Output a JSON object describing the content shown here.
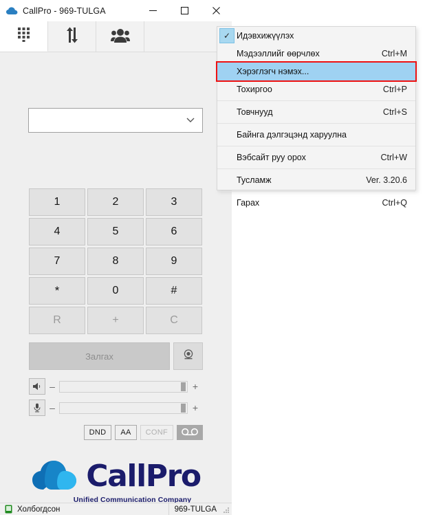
{
  "window": {
    "title": "CallPro - 969-TULGA",
    "app_icon": "cloud-icon",
    "controls": {
      "minimize": "—",
      "maximize": "☐",
      "close": "✕"
    }
  },
  "tabs": [
    {
      "name": "dialpad",
      "icon": "dialpad-icon",
      "active": true
    },
    {
      "name": "call-history",
      "icon": "transfer-arrows-icon",
      "active": false
    },
    {
      "name": "contacts",
      "icon": "contacts-group-icon",
      "active": false
    }
  ],
  "dialer": {
    "number_input": {
      "value": "",
      "placeholder": ""
    },
    "dropdown_icon": "chevron-down-icon",
    "keys": [
      {
        "label": "1",
        "dim": false
      },
      {
        "label": "2",
        "dim": false
      },
      {
        "label": "3",
        "dim": false
      },
      {
        "label": "4",
        "dim": false
      },
      {
        "label": "5",
        "dim": false
      },
      {
        "label": "6",
        "dim": false
      },
      {
        "label": "7",
        "dim": false
      },
      {
        "label": "8",
        "dim": false
      },
      {
        "label": "9",
        "dim": false
      },
      {
        "label": "*",
        "dim": false
      },
      {
        "label": "0",
        "dim": false
      },
      {
        "label": "#",
        "dim": false
      },
      {
        "label": "R",
        "dim": true
      },
      {
        "label": "+",
        "dim": true
      },
      {
        "label": "C",
        "dim": true
      }
    ],
    "call_button_label": "Залгах",
    "video_button_icon": "webcam-icon"
  },
  "sliders": {
    "speaker": {
      "icon": "speaker-icon",
      "minus": "–",
      "plus": "+",
      "value": 100
    },
    "microphone": {
      "icon": "microphone-icon",
      "minus": "–",
      "plus": "+",
      "value": 100
    }
  },
  "toggles": [
    {
      "label": "DND",
      "enabled": true
    },
    {
      "label": "AA",
      "enabled": true
    },
    {
      "label": "CONF",
      "enabled": false
    },
    {
      "label": "VM",
      "enabled": true,
      "icon": "voicemail-icon"
    }
  ],
  "logo": {
    "icon": "cloud-logo-icon",
    "word": "CallPro",
    "tagline": "Unified Communication Company",
    "color_dark": "#1b1c6b",
    "color_cloud": "#0f84c8"
  },
  "statusbar": {
    "icon": "connected-phone-icon",
    "status_text": "Холбогдсон",
    "extension": "969-TULGA",
    "grip_icon": "resize-grip-icon"
  },
  "context_menu": {
    "items": [
      {
        "label": "Идэвхижүүлэх",
        "shortcut": "",
        "checked": true,
        "highlighted": false,
        "separator_after": false
      },
      {
        "label": "Мэдээллийг өөрчлөх",
        "shortcut": "Ctrl+M",
        "checked": false,
        "highlighted": false,
        "separator_after": false
      },
      {
        "label": "Хэрэглэгч нэмэх...",
        "shortcut": "",
        "checked": false,
        "highlighted": true,
        "separator_after": false
      },
      {
        "label": "Тохиргоо",
        "shortcut": "Ctrl+P",
        "checked": false,
        "highlighted": false,
        "separator_after": true
      },
      {
        "label": "Товчнууд",
        "shortcut": "Ctrl+S",
        "checked": false,
        "highlighted": false,
        "separator_after": true
      },
      {
        "label": "Байнга дэлгэцэнд харуулна",
        "shortcut": "",
        "checked": false,
        "highlighted": false,
        "separator_after": true
      },
      {
        "label": "Вэбсайт руу орох",
        "shortcut": "Ctrl+W",
        "checked": false,
        "highlighted": false,
        "separator_after": true
      },
      {
        "label": "Тусламж",
        "shortcut": "Ver. 3.20.6",
        "checked": false,
        "highlighted": false,
        "separator_after": true
      },
      {
        "label": "Гарах",
        "shortcut": "Ctrl+Q",
        "checked": false,
        "highlighted": false,
        "separator_after": false
      }
    ],
    "highlight_color": "#9fd2f2",
    "annotation_color": "#ee1111",
    "check_mark": "✓"
  }
}
